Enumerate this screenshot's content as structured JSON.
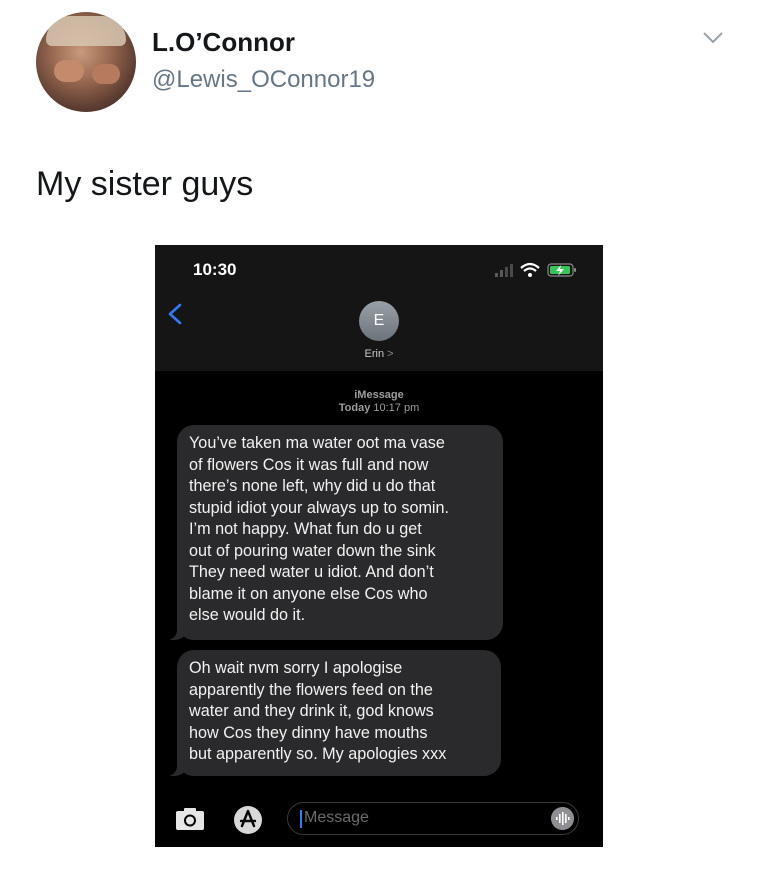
{
  "tweet": {
    "display_name": "L.O’Connor",
    "handle": "@Lewis_OConnor19",
    "text": "My sister guys",
    "menu_icon": "chevron-down-icon"
  },
  "phone": {
    "status": {
      "time": "10:30",
      "icons": [
        "cellular-signal-icon",
        "wifi-icon",
        "battery-charging-icon"
      ]
    },
    "contact": {
      "initial": "E",
      "name": "Erin",
      "arrow": ">"
    },
    "conversation": {
      "service": "iMessage",
      "day": "Today",
      "time": "10:17 pm"
    },
    "messages": [
      {
        "text": "You’ve taken ma water oot ma vase\nof flowers Cos it was full and now\nthere’s none left, why did u do that\nstupid idiot your always up to somin.\nI’m not happy. What fun do u get\nout of pouring water down the sink\nThey need water u idiot. And don’t\nblame it on anyone else Cos who\nelse would do it."
      },
      {
        "text": "Oh wait nvm sorry I apologise\napparently the flowers feed on the\nwater and they drink it, god knows\nhow Cos they dinny have mouths\nbut apparently so. My apologies xxx"
      }
    ],
    "composer": {
      "placeholder": "Message",
      "icons": [
        "camera-icon",
        "app-store-icon",
        "audio-message-icon"
      ]
    }
  },
  "colors": {
    "accent": "#2f7cf6",
    "bubble": "#2a2a2c",
    "handle_gray": "#657786"
  }
}
